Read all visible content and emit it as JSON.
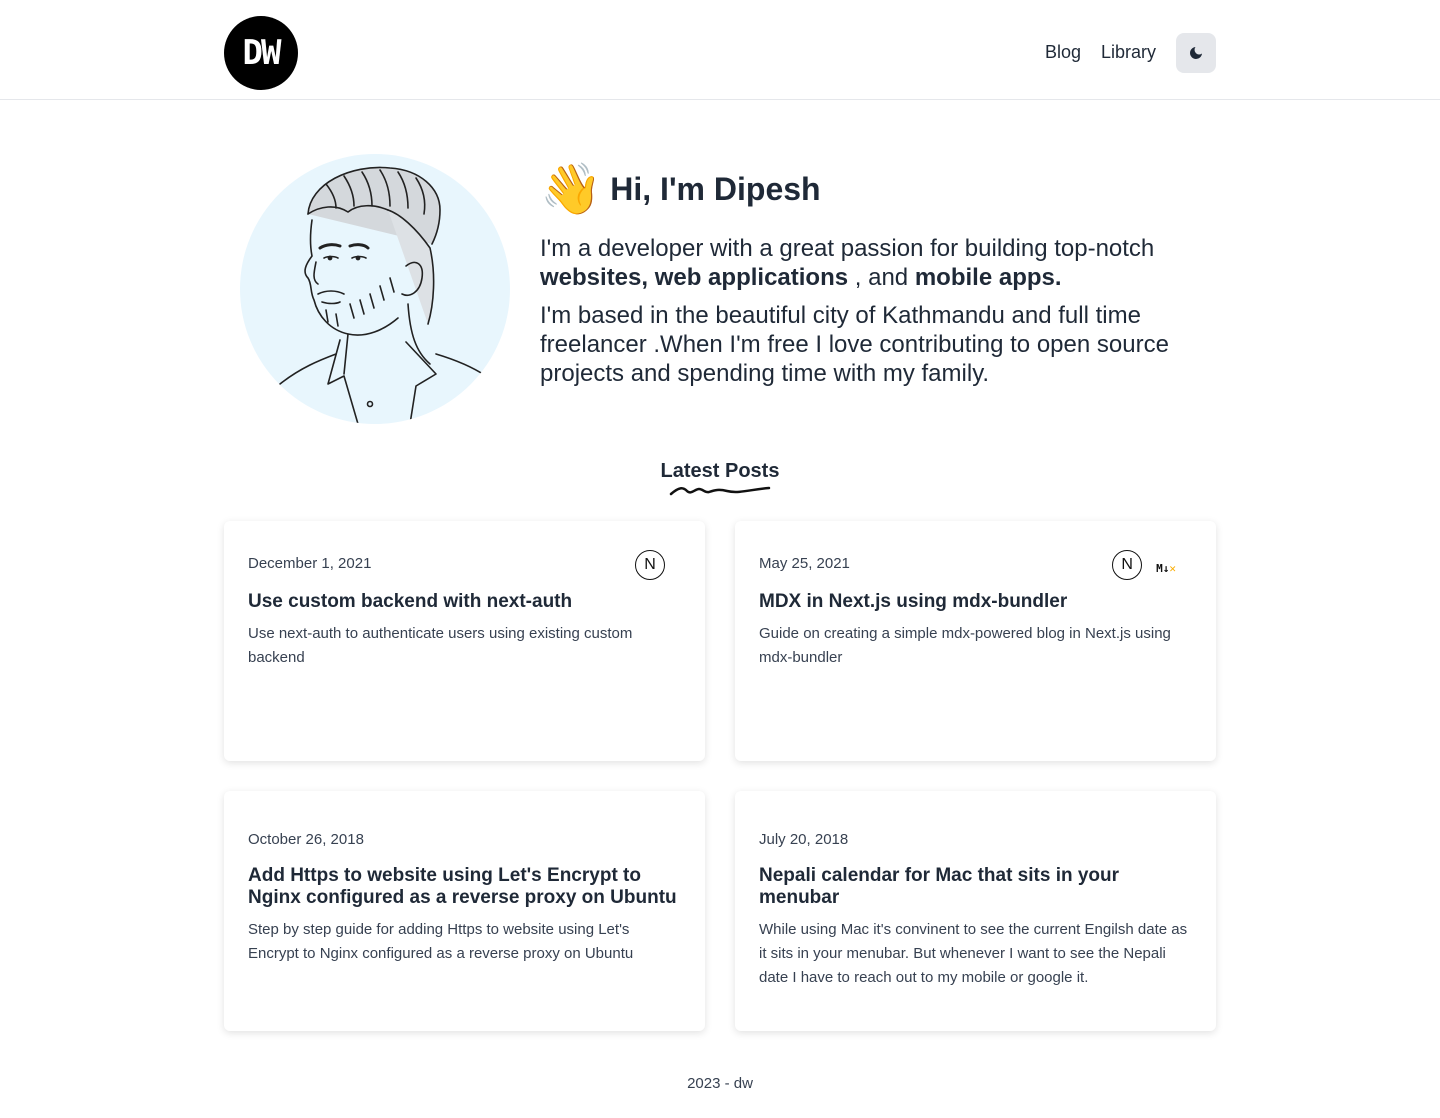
{
  "header": {
    "logo_text": "DW",
    "nav": [
      {
        "label": "Blog"
      },
      {
        "label": "Library"
      }
    ],
    "theme_icon": "moon-icon"
  },
  "hero": {
    "wave_emoji": "👋",
    "greeting": "Hi, I'm Dipesh",
    "line1_prefix": "I'm a developer with a great passion for building top-notch",
    "line1_bold": "websites, web applications",
    "line1_mid": ", and",
    "line1_bold2": "mobile apps.",
    "line2": "I'm based in the beautiful city of Kathmandu and full time freelancer .When I'm free I love contributing to open source projects and spending time with my family."
  },
  "latest": {
    "title": "Latest Posts"
  },
  "posts": [
    {
      "date": "December 1, 2021",
      "title": "Use custom backend with next-auth",
      "description": "Use next-auth to authenticate users using existing custom backend",
      "tags": [
        "nextjs-icon"
      ]
    },
    {
      "date": "May 25, 2021",
      "title": "MDX in Next.js using mdx-bundler",
      "description": "Guide on creating a simple mdx-powered blog in Next.js using mdx-bundler",
      "tags": [
        "nextjs-icon",
        "mdx-icon"
      ]
    },
    {
      "date": "October 26, 2018",
      "title": "Add Https to website using Let's Encrypt to Nginx configured as a reverse proxy on Ubuntu",
      "description": "Step by step guide for adding Https to website using Let's Encrypt to Nginx configured as a reverse proxy on Ubuntu",
      "tags": []
    },
    {
      "date": "July 20, 2018",
      "title": "Nepali calendar for Mac that sits in your menubar",
      "description": "While using Mac it's convinent to see the current Engilsh date as it sits in your menubar. But whenever I want to see the Nepali date I have to reach out to my mobile or google it.",
      "tags": []
    }
  ],
  "footer": {
    "text": "2023 - dw"
  },
  "colors": {
    "text": "#1f2937",
    "avatar_bg": "#e8f6fd",
    "mdx_accent": "#f9ac00",
    "toggle_bg": "#e5e7eb"
  }
}
